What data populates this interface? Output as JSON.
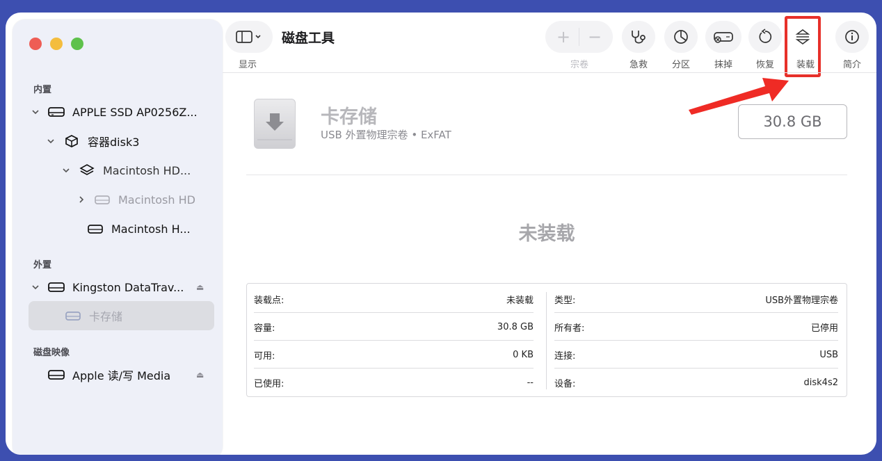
{
  "toolbar": {
    "title": "磁盘工具",
    "view_label": "显示",
    "volume_label": "宗卷",
    "first_aid_label": "急救",
    "partition_label": "分区",
    "erase_label": "抹掉",
    "restore_label": "恢复",
    "mount_label": "装载",
    "info_label": "简介"
  },
  "sidebar": {
    "internal_label": "内置",
    "external_label": "外置",
    "images_label": "磁盘映像",
    "items": [
      {
        "label": "APPLE SSD AP0256Z..."
      },
      {
        "label": "容器disk3"
      },
      {
        "label": "Macintosh HD..."
      },
      {
        "label": "Macintosh HD"
      },
      {
        "label": "Macintosh H..."
      },
      {
        "label": "Kingston DataTrav..."
      },
      {
        "label": "卡存储"
      },
      {
        "label": "Apple 读/写 Media"
      }
    ]
  },
  "volume": {
    "name": "卡存储",
    "subtitle": "USB 外置物理宗卷 • ExFAT",
    "size": "30.8 GB",
    "status": "未装载"
  },
  "info": {
    "left": [
      {
        "key": "装载点:",
        "value": "未装载"
      },
      {
        "key": "容量:",
        "value": "30.8 GB"
      },
      {
        "key": "可用:",
        "value": "0 KB"
      },
      {
        "key": "已使用:",
        "value": "--"
      }
    ],
    "right": [
      {
        "key": "类型:",
        "value": "USB外置物理宗卷"
      },
      {
        "key": "所有者:",
        "value": "已停用"
      },
      {
        "key": "连接:",
        "value": "USB"
      },
      {
        "key": "设备:",
        "value": "disk4s2"
      }
    ]
  },
  "colors": {
    "highlight": "#e7302a",
    "background": "#3d4fb0"
  }
}
